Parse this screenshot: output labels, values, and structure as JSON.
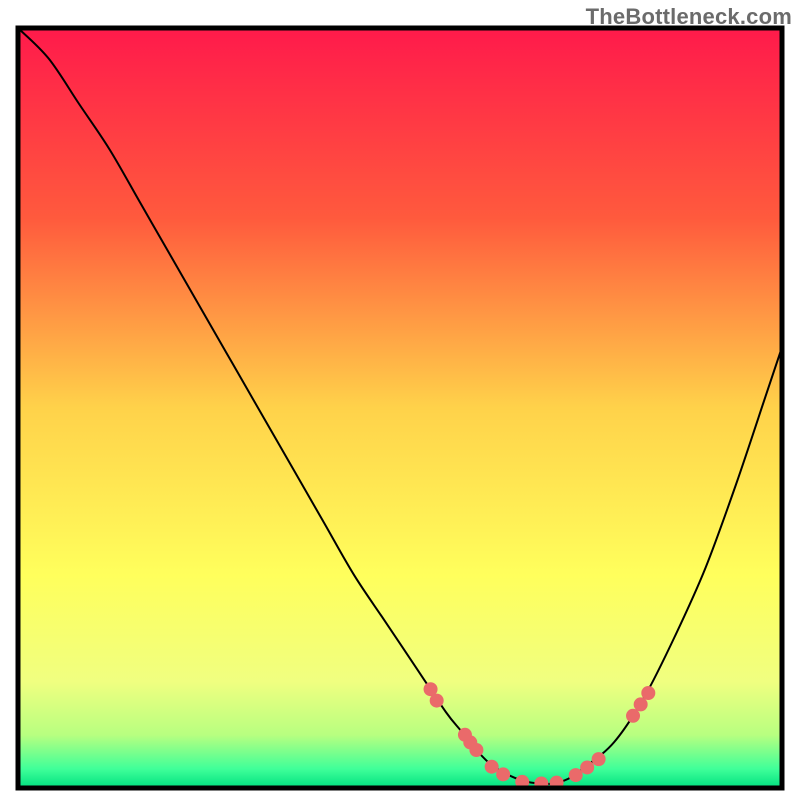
{
  "watermark": "TheBottleneck.com",
  "chart_data": {
    "type": "line",
    "title": "",
    "xlabel": "",
    "ylabel": "",
    "xlim": [
      0,
      100
    ],
    "ylim": [
      0,
      100
    ],
    "grid": false,
    "legend": false,
    "background_gradient": {
      "stops": [
        {
          "offset": 0.0,
          "color": "#ff1a4b"
        },
        {
          "offset": 0.25,
          "color": "#ff5a3d"
        },
        {
          "offset": 0.5,
          "color": "#ffd24a"
        },
        {
          "offset": 0.72,
          "color": "#ffff5c"
        },
        {
          "offset": 0.86,
          "color": "#f0ff80"
        },
        {
          "offset": 0.93,
          "color": "#b8ff80"
        },
        {
          "offset": 0.975,
          "color": "#3fff99"
        },
        {
          "offset": 1.0,
          "color": "#00e080"
        }
      ]
    },
    "series": [
      {
        "name": "bottleneck-curve",
        "color": "#000000",
        "width": 2,
        "x": [
          0,
          4,
          8,
          12,
          16,
          20,
          24,
          28,
          32,
          36,
          40,
          44,
          48,
          52,
          56,
          58,
          60,
          62,
          64,
          66,
          68,
          70,
          72,
          74,
          78,
          82,
          86,
          90,
          94,
          98,
          100
        ],
        "y": [
          100,
          96,
          90,
          84,
          77,
          70,
          63,
          56,
          49,
          42,
          35,
          28,
          22,
          16,
          10,
          7.5,
          5,
          3,
          1.8,
          1.0,
          0.6,
          0.6,
          1.2,
          2.6,
          6,
          12,
          20,
          29,
          40,
          52,
          58
        ]
      }
    ],
    "markers": {
      "name": "highlight-dots",
      "color": "#ea6a6a",
      "radius": 7,
      "x": [
        54.0,
        54.8,
        58.5,
        59.2,
        60.0,
        62.0,
        63.5,
        66.0,
        68.5,
        70.5,
        73.0,
        74.5,
        76.0,
        80.5,
        81.5,
        82.5
      ],
      "y": [
        13.0,
        11.5,
        7.0,
        6.0,
        5.0,
        2.8,
        1.8,
        0.8,
        0.6,
        0.7,
        1.7,
        2.7,
        3.8,
        9.5,
        11.0,
        12.5
      ]
    },
    "frame": {
      "color": "#000000",
      "width": 5
    }
  }
}
